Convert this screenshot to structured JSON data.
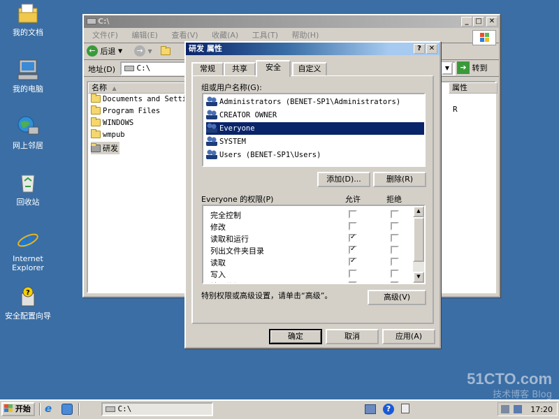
{
  "desktop": {
    "icons": [
      {
        "label": "我的文档"
      },
      {
        "label": "我的电脑"
      },
      {
        "label": "网上邻居"
      },
      {
        "label": "回收站"
      },
      {
        "label": "Internet Explorer"
      },
      {
        "label": "安全配置向导"
      }
    ]
  },
  "explorer": {
    "title": "C:\\",
    "menu": [
      "文件(F)",
      "编辑(E)",
      "查看(V)",
      "收藏(A)",
      "工具(T)",
      "帮助(H)"
    ],
    "back_label": "后退",
    "address_label": "地址(D)",
    "address_value": "C:\\",
    "go_label": "转到",
    "col_name": "名称",
    "col_attr": "属性",
    "attr_value": "R",
    "files": [
      "Documents and Settin",
      "Program Files",
      "WINDOWS",
      "wmpub",
      "研发"
    ]
  },
  "dialog": {
    "title": "研发 属性",
    "tabs": [
      "常规",
      "共享",
      "安全",
      "自定义"
    ],
    "group_label": "组或用户名称(G):",
    "users": [
      "Administrators (BENET-SP1\\Administrators)",
      "CREATOR OWNER",
      "Everyone",
      "SYSTEM",
      "Users (BENET-SP1\\Users)"
    ],
    "add_button": "添加(D)...",
    "remove_button": "删除(R)",
    "perm_label": "Everyone 的权限(P)",
    "allow_header": "允许",
    "deny_header": "拒绝",
    "permissions": [
      {
        "name": "完全控制",
        "allow": false,
        "deny": false
      },
      {
        "name": "修改",
        "allow": false,
        "deny": false
      },
      {
        "name": "读取和运行",
        "allow": true,
        "deny": false
      },
      {
        "name": "列出文件夹目录",
        "allow": true,
        "deny": false
      },
      {
        "name": "读取",
        "allow": true,
        "deny": false
      },
      {
        "name": "写入",
        "allow": false,
        "deny": false
      },
      {
        "name": "特别的权限",
        "allow": false,
        "deny": false
      }
    ],
    "advanced_hint": "特别权限或高级设置，请单击“高级”。",
    "advanced_button": "高级(V)",
    "ok_button": "确定",
    "cancel_button": "取消",
    "apply_button": "应用(A)"
  },
  "taskbar": {
    "start_label": "开始",
    "task_label": "C:\\",
    "clock": "17:20"
  },
  "watermark": {
    "line1": "51CTO.com",
    "line2": "技术博客 Blog"
  }
}
